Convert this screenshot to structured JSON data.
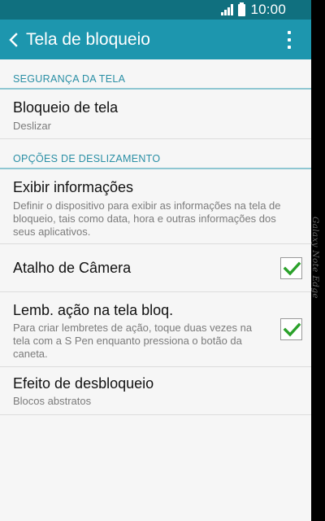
{
  "status_bar": {
    "time": "10:00",
    "icons": [
      "signal-icon",
      "battery-icon"
    ]
  },
  "app_bar": {
    "title": "Tela de bloqueio",
    "back_icon": "chevron-left-icon",
    "menu_icon": "more-vert-icon"
  },
  "sections": {
    "security": {
      "header": "SEGURANÇA DA TELA",
      "screen_lock": {
        "title": "Bloqueio de tela",
        "value": "Deslizar"
      }
    },
    "swipe": {
      "header": "OPÇÕES DE DESLIZAMENTO",
      "show_info": {
        "title": "Exibir informações",
        "description": "Definir o dispositivo para exibir as informações na tela de bloqueio, tais como data, hora e outras informações dos seus aplicativos."
      },
      "camera_shortcut": {
        "title": "Atalho de Câmera",
        "checked": true
      },
      "action_memo": {
        "title": "Lemb. ação na tela bloq.",
        "description": "Para criar lembretes de ação, toque duas vezes na tela com a S Pen enquanto pressiona o botão da caneta.",
        "checked": true
      },
      "unlock_effect": {
        "title": "Efeito de desbloqueio",
        "value": "Blocos abstratos"
      }
    }
  },
  "device_edge_label": "Galaxy Note Edge",
  "colors": {
    "status_bar": "#10707f",
    "app_bar": "#1d96ae",
    "accent": "#2a8fa5",
    "check": "#2aa12a",
    "background": "#f6f6f6"
  }
}
